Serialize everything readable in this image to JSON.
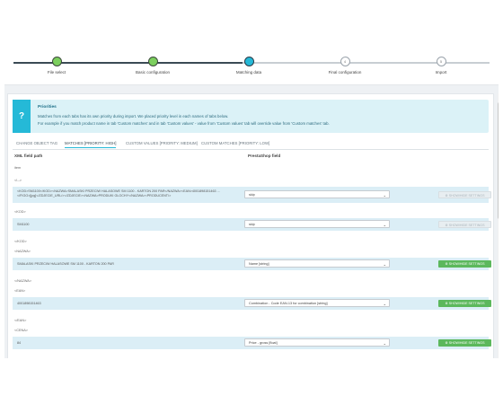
{
  "stepper": {
    "steps": [
      {
        "label": "File select",
        "state": "done"
      },
      {
        "label": "Basic configuration",
        "state": "done"
      },
      {
        "label": "Matching data",
        "state": "active"
      },
      {
        "label": "Final configuration",
        "state": "todo",
        "number": "4"
      },
      {
        "label": "Import",
        "state": "todo",
        "number": "5"
      }
    ],
    "colors": {
      "done": "#7ccf5e",
      "active": "#25b9d7"
    }
  },
  "alert": {
    "icon": "question-icon",
    "icon_glyph": "?",
    "title": "Priorities",
    "line1": "Matches from each tabs has its own priority during import. We placed priority level in each names of tabs below.",
    "line2": "For example if you match product name in tab 'Custom matches' and in tab 'Custom values' - value from 'Custom values' tab will override value from 'Custom matches' tab."
  },
  "tabs": [
    "CHANGE OBJECT TAG",
    "MATCHES [PRIORITY: HIGH]",
    "CUSTOM VALUES [PRIORITY: MEDIUM]",
    "CUSTOM MATCHES [PRIORITY: LOW]"
  ],
  "table": {
    "col_xml": "XML field path",
    "col_ps": "PrestaShop field"
  },
  "tags": {
    "item": "item",
    "comment": "<!-->",
    "kod_open": "<KOD>",
    "kod_close": "</KOD>",
    "nazwa_open": "<NAZWA>",
    "nazwa_close": "</NAZWA>",
    "ean_open": "<EAN>",
    "ean_close": "</EAN>",
    "cena_open": "<CENA>"
  },
  "rows": [
    {
      "text1": "<KOD>SM1100</KOD><NAZWA>SMALASKI PRZECIW HALASOWE SM 1100 - KARTON 200 PAR</NAZWA><EAN>4001898151463 ...",
      "text2": "</FIGO>[jpg]</ZDJECIE_URL/></ZDJECIE><NAZWA>PRODUKI GLOCHY</NAZWA><PRODUCENT/>",
      "select": "skip",
      "button": "SHOW/HIDE SETTINGS",
      "btn_state": "disabled"
    },
    {
      "text1": "SM1100",
      "select": "skip",
      "button": "SHOW/HIDE SETTINGS",
      "btn_state": "disabled"
    },
    {
      "text1": "SMALASKI PRZECIW HALASOWE SM 1100 - KARTON 200 PAR",
      "select": "Name [string]",
      "button": "SHOW/HIDE SETTINGS",
      "btn_state": "enabled"
    },
    {
      "text1": "4001898151463",
      "select": "Combination - Code EAN-13 for combination [string]",
      "button": "SHOW/HIDE SETTINGS",
      "btn_state": "enabled"
    },
    {
      "text1": "84",
      "select": "Price - gross [float]",
      "button": "SHOW/HIDE SETTINGS",
      "btn_state": "enabled"
    }
  ]
}
